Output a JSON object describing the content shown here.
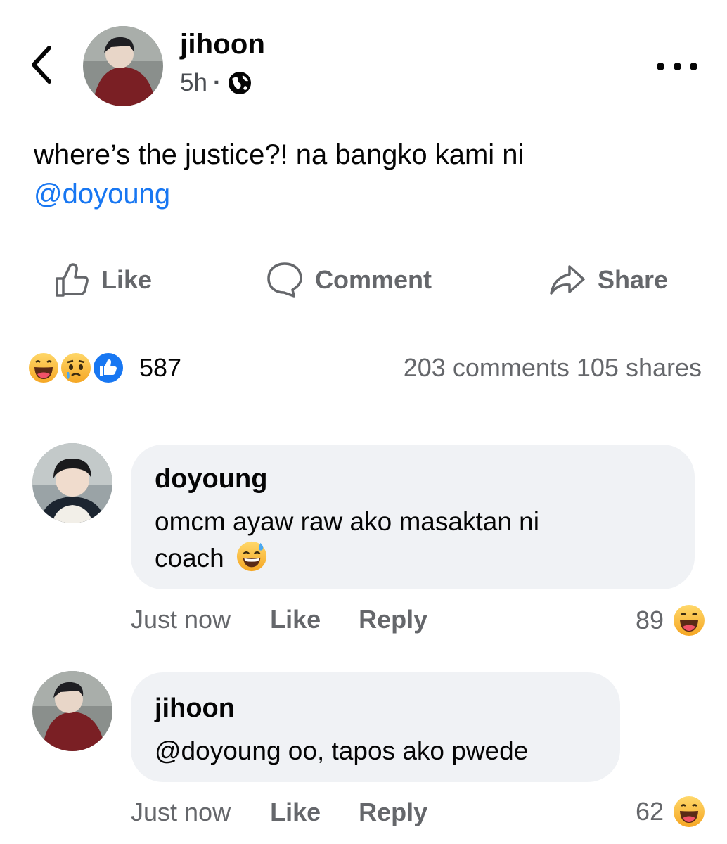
{
  "post": {
    "author": "jihoon",
    "time": "5h",
    "separator": "·",
    "privacy_icon": "globe-icon",
    "text": "where’s the justice?! na bangko kami ni",
    "mention": "@doyoung"
  },
  "actions": {
    "like": "Like",
    "comment": "Comment",
    "share": "Share"
  },
  "reactions": {
    "icons": [
      "haha-emoji",
      "sad-emoji",
      "like-emoji"
    ],
    "count": "587",
    "comments_shares": "203 comments 105 shares"
  },
  "comments": [
    {
      "author": "doyoung",
      "line1": "omcm ayaw raw ako masaktan ni",
      "line2": "coach",
      "emoji": "sweat-smile-emoji",
      "time": "Just now",
      "like": "Like",
      "reply": "Reply",
      "reaction_count": "89",
      "reaction_icon": "haha-emoji"
    },
    {
      "author": "jihoon",
      "text": "@doyoung oo, tapos ako pwede",
      "time": "Just now",
      "like": "Like",
      "reply": "Reply",
      "reaction_count": "62",
      "reaction_icon": "haha-emoji"
    }
  ],
  "colors": {
    "accent": "#1877f2",
    "muted": "#65676b",
    "bubble": "#f0f2f5"
  }
}
